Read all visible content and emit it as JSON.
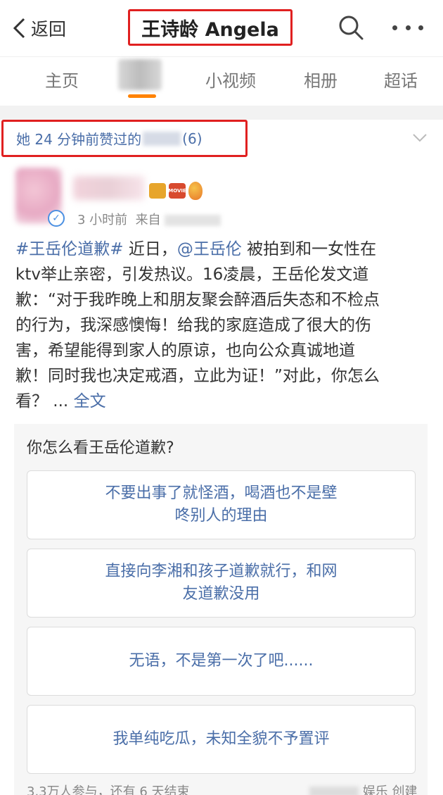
{
  "header": {
    "back_label": "返回",
    "title": "王诗龄 Angela"
  },
  "tabs": [
    {
      "label": "主页"
    },
    {
      "label": ""
    },
    {
      "label": "小视频"
    },
    {
      "label": "相册"
    },
    {
      "label": "超话"
    }
  ],
  "like_bar": {
    "prefix": "她 24 分钟前赞过的",
    "count": "(6)"
  },
  "post": {
    "time": "3 小时前",
    "source_prefix": "来自",
    "hashtag": "#王岳伦道歉#",
    "lines": [
      "近日，",
      "被拍到和一女性在",
      "ktv举止亲密，引发热议。16凌晨，王岳伦发文道",
      "歉：“对于我昨晚上和朋友聚会醉酒后失态和不检点",
      "的行为，我深感懊悔！给我的家庭造成了很大的伤",
      "害，希望能得到家人的原谅，也向公众真诚地道",
      "歉！同时我也决定戒酒，立此为证！”对此，你怎么",
      "看？ ..."
    ],
    "mention": "@王岳伦",
    "full_text_link": "全文"
  },
  "poll": {
    "question": "你怎么看王岳伦道歉?",
    "options": [
      {
        "line1": "不要出事了就怪酒，喝酒也不是壁",
        "line2": "咚别人的理由"
      },
      {
        "line1": "直接向李湘和孩子道歉就行，和网",
        "line2": "友道歉没用"
      },
      {
        "line1": "无语，不是第一次了吧......",
        "line2": ""
      },
      {
        "line1": "我单纯吃瓜，未知全貌不予置评",
        "line2": ""
      }
    ],
    "footer_left": "3.3万人参与，还有 6 天结束",
    "footer_right": "娱乐 创建"
  },
  "colors": {
    "link": "#4a6ea8",
    "highlight_border": "#e02020",
    "tab_indicator": "#ff8200"
  }
}
